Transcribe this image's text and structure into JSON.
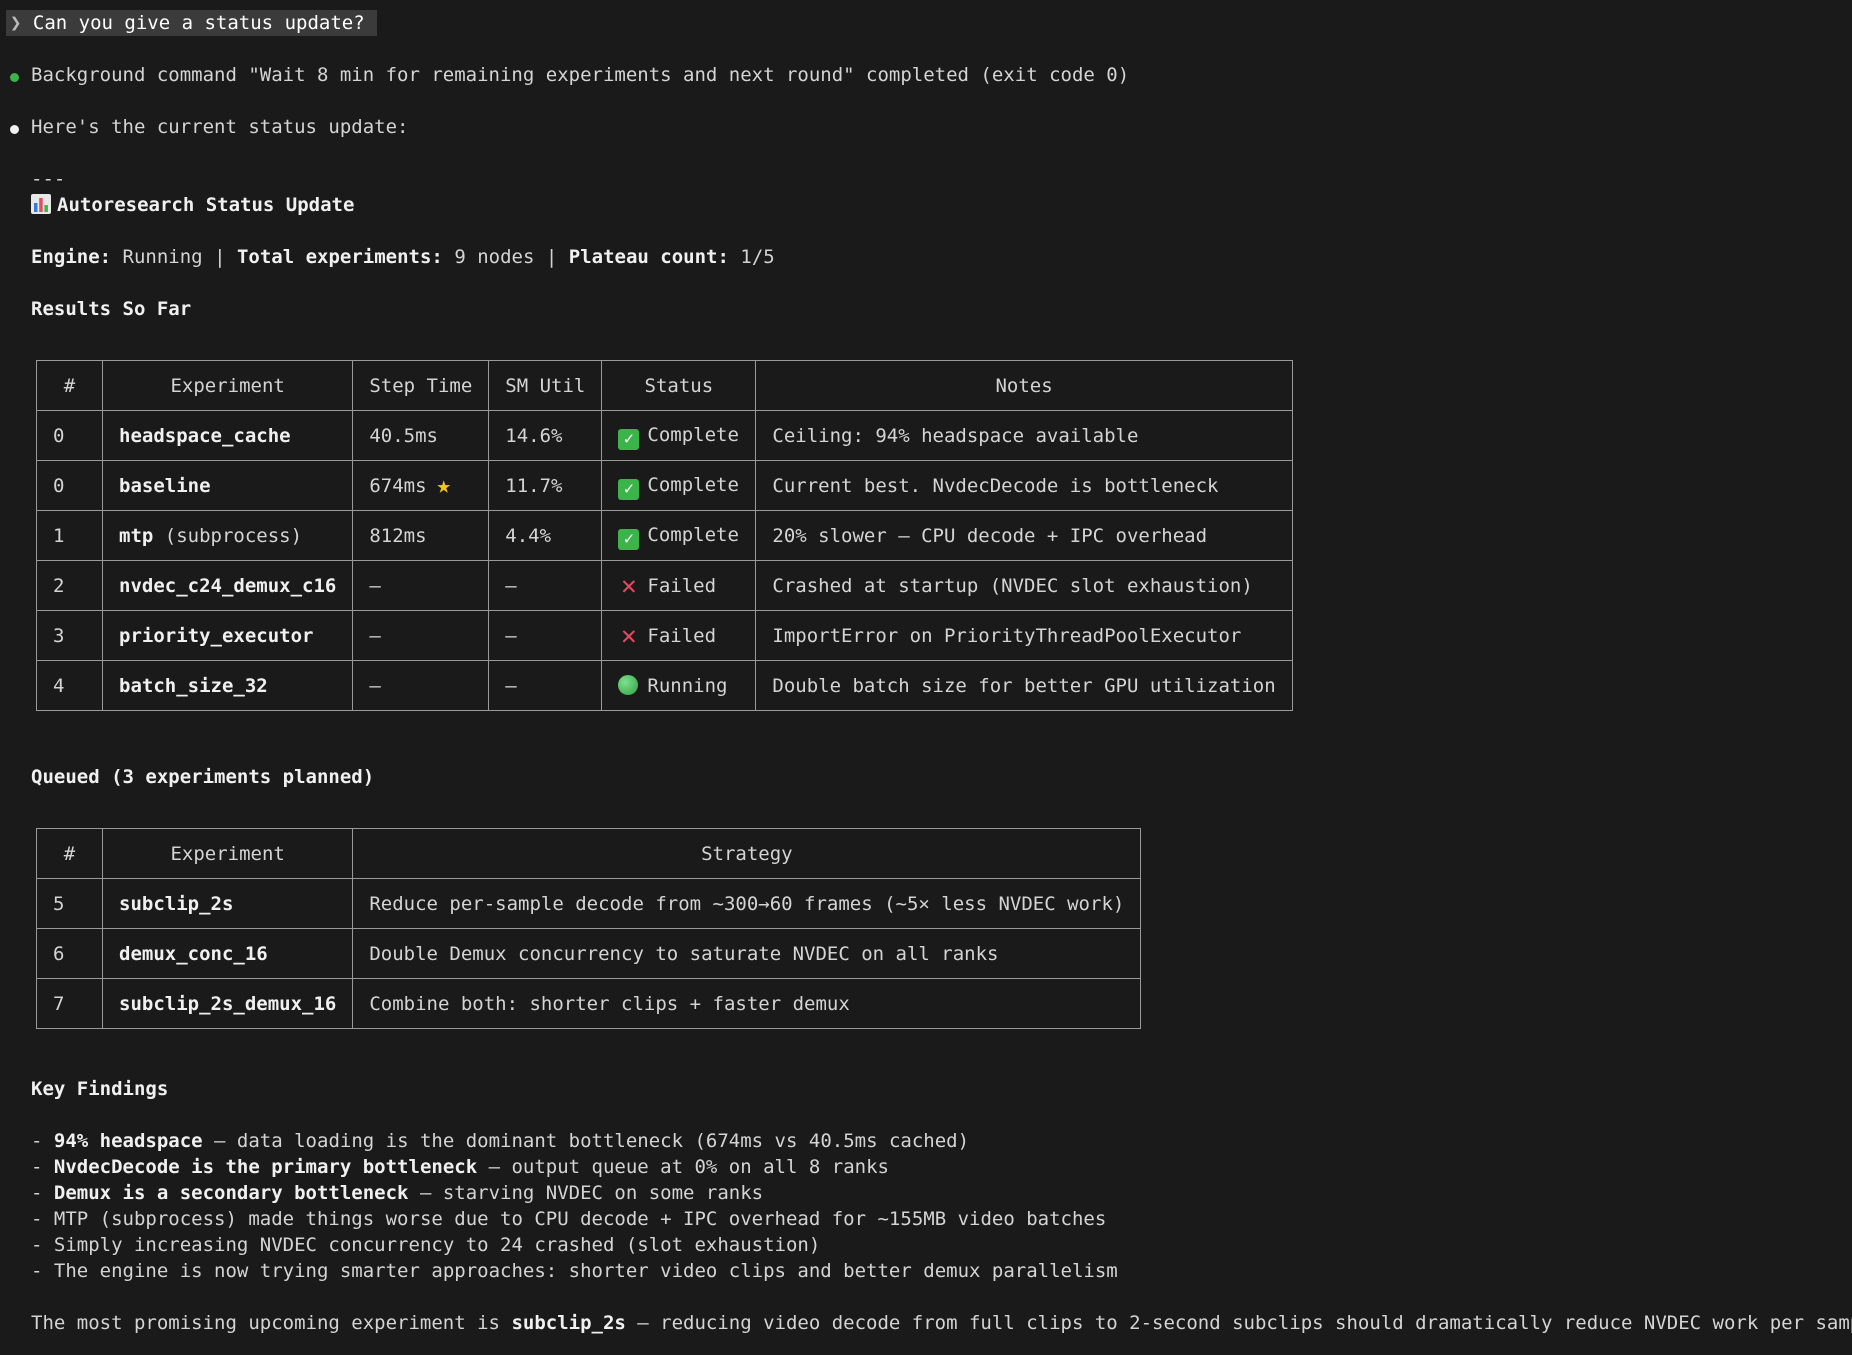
{
  "prompt": {
    "chevron": "❯",
    "text": "Can you give a status update?"
  },
  "bg_command": "Background command \"Wait 8 min for remaining experiments and next round\" completed (exit code 0)",
  "intro": "Here's the current status update:",
  "separator": "---",
  "heading": {
    "icon": "bar-chart-icon",
    "text": "Autoresearch Status Update"
  },
  "engine": {
    "engine_label": "Engine:",
    "engine_value": "Running",
    "sep": "|",
    "total_label": "Total experiments:",
    "total_value": "9 nodes",
    "plateau_label": "Plateau count:",
    "plateau_value": "1/5"
  },
  "results": {
    "title": "Results So Far",
    "headers": [
      "#",
      "Experiment",
      "Step Time",
      "SM Util",
      "Status",
      "Notes"
    ],
    "rows": [
      {
        "num": "0",
        "name": "headspace_cache",
        "suffix": "",
        "step": "40.5ms",
        "star": false,
        "sm": "14.6%",
        "status": "Complete",
        "status_type": "complete",
        "notes": "Ceiling: 94% headspace available"
      },
      {
        "num": "0",
        "name": "baseline",
        "suffix": "",
        "step": "674ms",
        "star": true,
        "sm": "11.7%",
        "status": "Complete",
        "status_type": "complete",
        "notes": "Current best. NvdecDecode is bottleneck"
      },
      {
        "num": "1",
        "name": "mtp",
        "suffix": " (subprocess)",
        "step": "812ms",
        "star": false,
        "sm": "4.4%",
        "status": "Complete",
        "status_type": "complete",
        "notes": "20% slower — CPU decode + IPC overhead"
      },
      {
        "num": "2",
        "name": "nvdec_c24_demux_c16",
        "suffix": "",
        "step": "—",
        "star": false,
        "sm": "—",
        "status": "Failed",
        "status_type": "failed",
        "notes": "Crashed at startup (NVDEC slot exhaustion)"
      },
      {
        "num": "3",
        "name": "priority_executor",
        "suffix": "",
        "step": "—",
        "star": false,
        "sm": "—",
        "status": "Failed",
        "status_type": "failed",
        "notes": "ImportError on PriorityThreadPoolExecutor"
      },
      {
        "num": "4",
        "name": "batch_size_32",
        "suffix": "",
        "step": "—",
        "star": false,
        "sm": "—",
        "status": "Running",
        "status_type": "running",
        "notes": "Double batch size for better GPU utilization"
      }
    ]
  },
  "queued": {
    "title": "Queued (3 experiments planned)",
    "headers": [
      "#",
      "Experiment",
      "Strategy"
    ],
    "rows": [
      {
        "num": "5",
        "name": "subclip_2s",
        "strategy": "Reduce per-sample decode from ~300→60 frames (~5× less NVDEC work)"
      },
      {
        "num": "6",
        "name": "demux_conc_16",
        "strategy": "Double Demux concurrency to saturate NVDEC on all ranks"
      },
      {
        "num": "7",
        "name": "subclip_2s_demux_16",
        "strategy": "Combine both: shorter clips + faster demux"
      }
    ]
  },
  "findings": {
    "title": "Key Findings",
    "items": [
      {
        "bold": "94% headspace",
        "rest": " — data loading is the dominant bottleneck (674ms vs 40.5ms cached)"
      },
      {
        "bold": "NvdecDecode is the primary bottleneck",
        "rest": " — output queue at 0% on all 8 ranks"
      },
      {
        "bold": "Demux is a secondary bottleneck",
        "rest": " — starving NVDEC on some ranks"
      },
      {
        "bold": "",
        "rest": "MTP (subprocess) made things worse due to CPU decode + IPC overhead for ~155MB video batches"
      },
      {
        "bold": "",
        "rest": "Simply increasing NVDEC concurrency to 24 crashed (slot exhaustion)"
      },
      {
        "bold": "",
        "rest": "The engine is now trying smarter approaches: shorter video clips and better demux parallelism"
      }
    ]
  },
  "conclusion": {
    "pre": "The most promising upcoming experiment is ",
    "bold": "subclip_2s",
    "post": " — reducing video decode from full clips to 2-second subclips should dramatically reduce NVDEC work per sample."
  }
}
